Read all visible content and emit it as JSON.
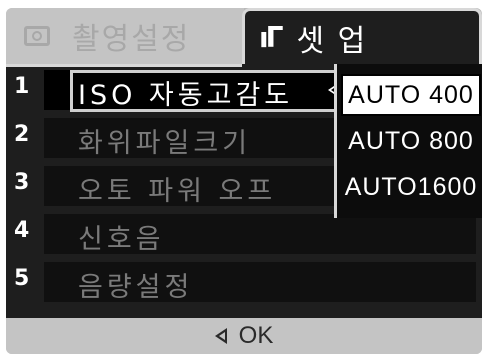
{
  "tabs": {
    "shooting": {
      "label": "촬영설정",
      "icon": "camera-icon"
    },
    "setup": {
      "label": "셋 업",
      "icon": "tools-icon",
      "icon_glyph": "ıГ"
    }
  },
  "menu": {
    "items": [
      {
        "number": "1",
        "label": "ISO 자동고감도"
      },
      {
        "number": "2",
        "label": "화위파일크기"
      },
      {
        "number": "3",
        "label": "오토 파워 오프"
      },
      {
        "number": "4",
        "label": "신호음"
      },
      {
        "number": "5",
        "label": "음량설정"
      }
    ],
    "selected_index": 0
  },
  "dropdown": {
    "options": [
      "AUTO 400",
      "AUTO 800",
      "AUTO1600"
    ],
    "selected": "AUTO 400"
  },
  "footer": {
    "ok_label": "OK",
    "icon": "back-arrow-icon"
  },
  "colors": {
    "background": "#1e1e1e",
    "frame": "#b9b9b9",
    "active_text": "#ffffff",
    "inactive_text": "#7a7a7a"
  }
}
